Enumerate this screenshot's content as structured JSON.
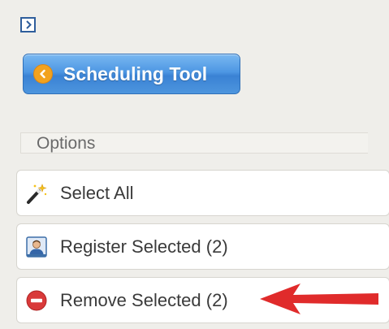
{
  "sidebar": {
    "expand_icon": "chevron-right-icon",
    "scheduling_button": {
      "label": "Scheduling Tool",
      "icon": "chevron-left-circle-icon"
    },
    "options_header": "Options",
    "actions": [
      {
        "label": "Select All",
        "icon": "magic-wand-icon"
      },
      {
        "label": "Register Selected (2)",
        "icon": "user-card-icon"
      },
      {
        "label": "Remove Selected (2)",
        "icon": "remove-circle-icon"
      }
    ]
  },
  "colors": {
    "panel_bg": "#efeeea",
    "button_blue": "#4d97e3",
    "remove_red": "#d93a3a",
    "arrow_red": "#e02b2b"
  }
}
